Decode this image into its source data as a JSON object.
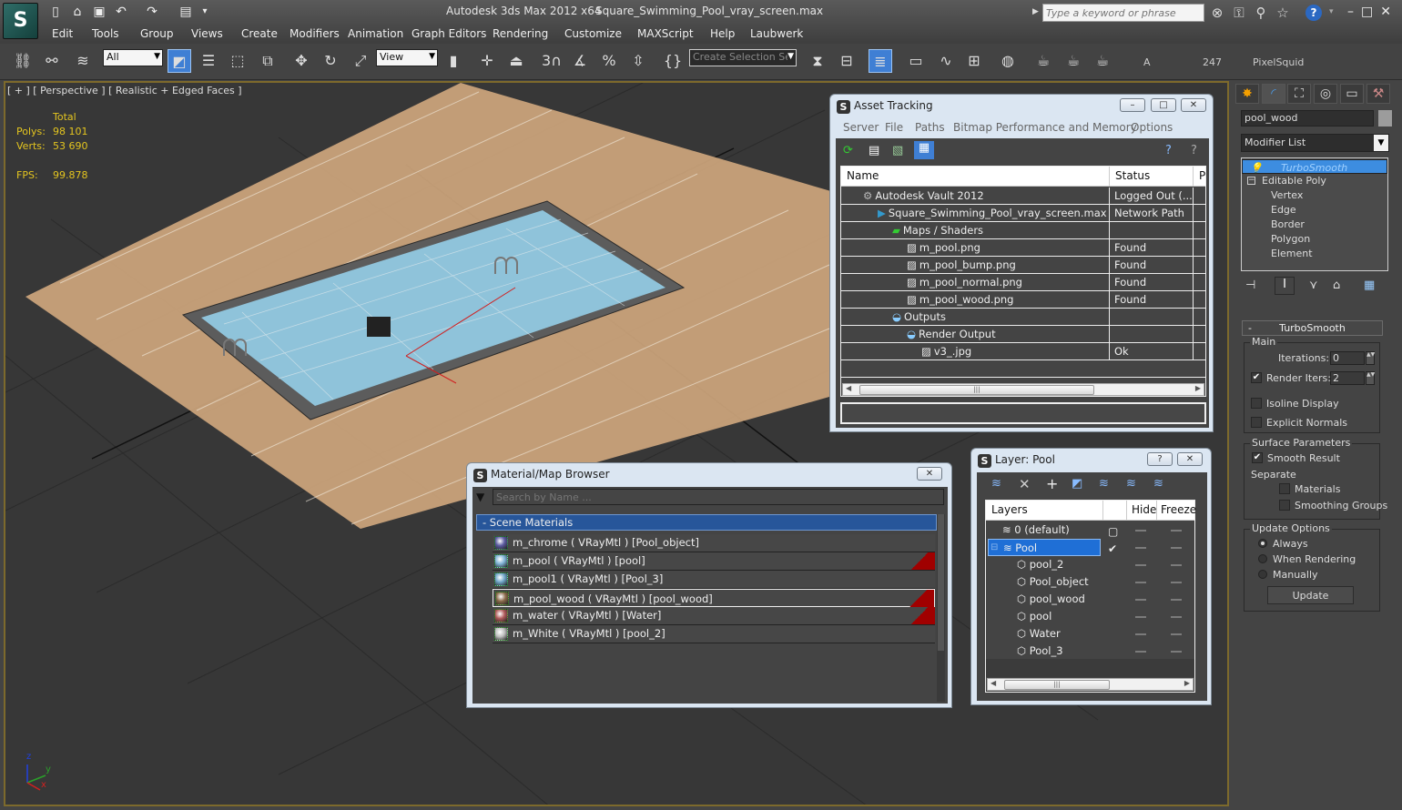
{
  "app": {
    "title": "Autodesk 3ds Max  2012 x64",
    "file": "Square_Swimming_Pool_vray_screen.max",
    "search_placeholder": "Type a keyword or phrase"
  },
  "menu": [
    "Edit",
    "Tools",
    "Group",
    "Views",
    "Create",
    "Modifiers",
    "Animation",
    "Graph Editors",
    "Rendering",
    "Customize",
    "MAXScript",
    "Help",
    "Laubwerk"
  ],
  "toolbar": {
    "selection_filter": "All",
    "ref_coord": "View",
    "named_selection": "Create Selection Se",
    "snap_label": "3",
    "text_a": "A",
    "text_247": "247",
    "pixelsquid": "PixelSquid"
  },
  "viewport": {
    "label": "[ + ] [ Perspective ] [ Realistic + Edged Faces ]",
    "stats": {
      "header": "Total",
      "polys_label": "Polys:",
      "polys": "98 101",
      "verts_label": "Verts:",
      "verts": "53 690",
      "fps_label": "FPS:",
      "fps": "99.878"
    },
    "axis": {
      "x": "x",
      "y": "y",
      "z": "z"
    }
  },
  "command_panel": {
    "object_name": "pool_wood",
    "modifier_list": "Modifier List",
    "stack": [
      {
        "label": "TurboSmooth",
        "selected": true
      },
      {
        "label": "Editable Poly"
      },
      {
        "label": "Vertex"
      },
      {
        "label": "Edge"
      },
      {
        "label": "Border"
      },
      {
        "label": "Polygon"
      },
      {
        "label": "Element"
      }
    ],
    "turbosmooth": {
      "title": "TurboSmooth",
      "collapse": "-",
      "main_group": "Main",
      "iterations_label": "Iterations:",
      "iterations": "0",
      "render_iters_label": "Render Iters:",
      "render_iters": "2",
      "render_iters_checked": true,
      "isoline": "Isoline Display",
      "explicit_normals": "Explicit Normals",
      "surface_group": "Surface Parameters",
      "smooth_result": "Smooth Result",
      "separate": "Separate",
      "materials": "Materials",
      "smoothing_groups": "Smoothing Groups",
      "update_group": "Update Options",
      "always": "Always",
      "when_rendering": "When Rendering",
      "manually": "Manually",
      "update_btn": "Update",
      "selected_update": "Always"
    }
  },
  "asset_tracking": {
    "title": "Asset Tracking",
    "menu": [
      "Server",
      "File",
      "Paths",
      "Bitmap Performance and Memory",
      "Options"
    ],
    "columns": [
      "Name",
      "Status",
      "P"
    ],
    "rows": [
      {
        "name": "Autodesk Vault 2012",
        "status": "Logged Out (...",
        "indent": 0,
        "icon": "vault-icon"
      },
      {
        "name": "Square_Swimming_Pool_vray_screen.max",
        "status": "Network Path",
        "indent": 1,
        "icon": "max-file-icon"
      },
      {
        "name": "Maps / Shaders",
        "status": "",
        "indent": 2,
        "icon": "maps-icon"
      },
      {
        "name": "m_pool.png",
        "status": "Found",
        "indent": 3,
        "icon": "bitmap-icon"
      },
      {
        "name": "m_pool_bump.png",
        "status": "Found",
        "indent": 3,
        "icon": "bitmap-icon"
      },
      {
        "name": "m_pool_normal.png",
        "status": "Found",
        "indent": 3,
        "icon": "bitmap-icon"
      },
      {
        "name": "m_pool_wood.png",
        "status": "Found",
        "indent": 3,
        "icon": "bitmap-icon"
      },
      {
        "name": "Outputs",
        "status": "",
        "indent": 2,
        "icon": "outputs-icon"
      },
      {
        "name": "Render Output",
        "status": "",
        "indent": 3,
        "icon": "outputs-icon"
      },
      {
        "name": "v3_.jpg",
        "status": "Ok",
        "indent": 4,
        "icon": "bitmap-icon"
      }
    ]
  },
  "material_browser": {
    "title": "Material/Map Browser",
    "search_placeholder": "Search by Name ...",
    "group": "- Scene Materials",
    "materials": [
      {
        "label": "m_chrome  ( VRayMtl ) [Pool_object]",
        "swatch": "#5a5aa0",
        "flag": false
      },
      {
        "label": "m_pool  ( VRayMtl ) [pool]",
        "swatch": "#7fb3d6",
        "flag": true
      },
      {
        "label": "m_pool1  ( VRayMtl ) [Pool_3]",
        "swatch": "#6fa5c8",
        "flag": false
      },
      {
        "label": "m_pool_wood  ( VRayMtl ) [pool_wood]",
        "swatch": "#8a6a4a",
        "flag": true,
        "selected": true
      },
      {
        "label": "m_water  ( VRayMtl ) [Water]",
        "swatch": "#b05a5a",
        "flag": true
      },
      {
        "label": "m_White  ( VRayMtl ) [pool_2]",
        "swatch": "#bdbdbd",
        "flag": false
      }
    ]
  },
  "layer_window": {
    "title": "Layer: Pool",
    "columns": [
      "Layers",
      "Hide",
      "Freeze"
    ],
    "layers": [
      {
        "name": "0 (default)",
        "type": "layer",
        "indent": 0,
        "current": false
      },
      {
        "name": "Pool",
        "type": "layer",
        "indent": 0,
        "current": true,
        "selected": true
      },
      {
        "name": "pool_2",
        "type": "object",
        "indent": 1
      },
      {
        "name": "Pool_object",
        "type": "object",
        "indent": 1
      },
      {
        "name": "pool_wood",
        "type": "object",
        "indent": 1
      },
      {
        "name": "pool",
        "type": "object",
        "indent": 1
      },
      {
        "name": "Water",
        "type": "object",
        "indent": 1
      },
      {
        "name": "Pool_3",
        "type": "object",
        "indent": 1
      }
    ]
  },
  "colors": {
    "accent": "#3d8de0",
    "viewport_border": "#7d6a2c",
    "stats": "#e4c51f",
    "flag": "#a00000"
  }
}
